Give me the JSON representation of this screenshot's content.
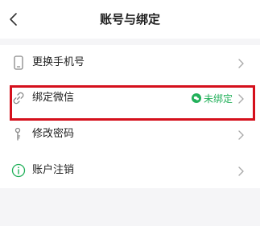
{
  "header": {
    "title": "账号与绑定",
    "back_icon": "chevron-left-icon"
  },
  "rows": [
    {
      "label": "更换手机号",
      "icon": "phone-icon"
    },
    {
      "label": "绑定微信",
      "icon": "link-icon",
      "status": "未绑定",
      "status_color": "#22b05a",
      "highlighted": true
    },
    {
      "label": "修改密码",
      "icon": "key-icon"
    },
    {
      "label": "账户注销",
      "icon": "info-icon"
    }
  ],
  "colors": {
    "highlight_border": "#d5101c",
    "accent_green": "#22b05a",
    "background": "#f5f5f7"
  }
}
